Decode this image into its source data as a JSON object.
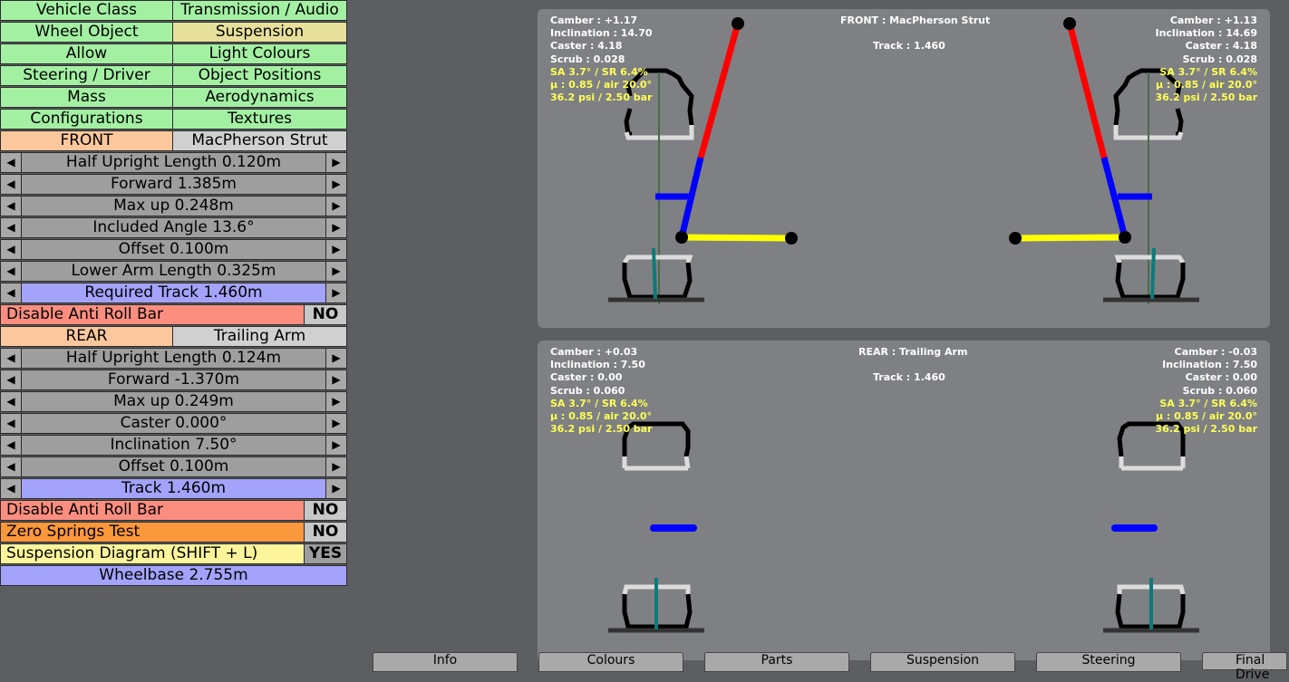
{
  "menu": {
    "rows": [
      [
        "Vehicle Class",
        "Transmission / Audio"
      ],
      [
        "Wheel Object",
        "Suspension"
      ],
      [
        "Allow",
        "Light Colours"
      ],
      [
        "Steering / Driver",
        "Object Positions"
      ],
      [
        "Mass",
        "Aerodynamics"
      ],
      [
        "Configurations",
        "Textures"
      ]
    ],
    "selected": "Suspension"
  },
  "front": {
    "axle_label": "FRONT",
    "type_label": "MacPherson Strut",
    "params": [
      "Half Upright Length 0.120m",
      "Forward 1.385m",
      "Max up 0.248m",
      "Included Angle 13.6°",
      "Offset 0.100m",
      "Lower Arm Length 0.325m"
    ],
    "track_param": "Required Track 1.460m",
    "anti_roll_label": "Disable Anti Roll Bar",
    "anti_roll_value": "NO"
  },
  "rear": {
    "axle_label": "REAR",
    "type_label": "Trailing Arm",
    "params": [
      "Half Upright Length 0.124m",
      "Forward -1.370m",
      "Max up 0.249m",
      "Caster 0.000°",
      "Inclination 7.50°",
      "Offset 0.100m"
    ],
    "track_param": "Track 1.460m",
    "anti_roll_label": "Disable Anti Roll Bar",
    "anti_roll_value": "NO"
  },
  "zero_springs": {
    "label": "Zero Springs Test",
    "value": "NO"
  },
  "diagram_toggle": {
    "label": "Suspension Diagram (SHIFT + L)",
    "value": "YES"
  },
  "wheelbase": "Wheelbase 2.755m",
  "arrows": {
    "left": "◀",
    "right": "▶"
  },
  "diagram": {
    "front": {
      "title": "FRONT : MacPherson Strut",
      "track": "Track : 1.460",
      "left_info": [
        "Camber : +1.17",
        "Inclination : 14.70",
        "Caster : 4.18",
        "Scrub : 0.028"
      ],
      "right_info": [
        "Camber : +1.13",
        "Inclination : 14.69",
        "Caster : 4.18",
        "Scrub : 0.028"
      ],
      "tyre_info": [
        "SA 3.7° / SR 6.4%",
        "µ : 0.85 / air 20.0°",
        "36.2 psi / 2.50 bar"
      ]
    },
    "rear": {
      "title": "REAR : Trailing Arm",
      "track": "Track : 1.460",
      "left_info": [
        "Camber : +0.03",
        "Inclination : 7.50",
        "Caster : 0.00",
        "Scrub : 0.060"
      ],
      "right_info": [
        "Camber : -0.03",
        "Inclination : 7.50",
        "Caster : 0.00",
        "Scrub : 0.060"
      ],
      "tyre_info": [
        "SA 3.7° / SR 6.4%",
        "µ : 0.85 / air 20.0°",
        "36.2 psi / 2.50 bar"
      ]
    },
    "colors": {
      "strut_upper": "#ff0000",
      "strut_lower": "#0000ff",
      "lower_arm": "#ffff00",
      "panel_bg": "#7f8083"
    }
  },
  "bottom_tabs": [
    "Info",
    "Colours",
    "Parts",
    "Suspension",
    "Steering",
    "Final Drive"
  ]
}
